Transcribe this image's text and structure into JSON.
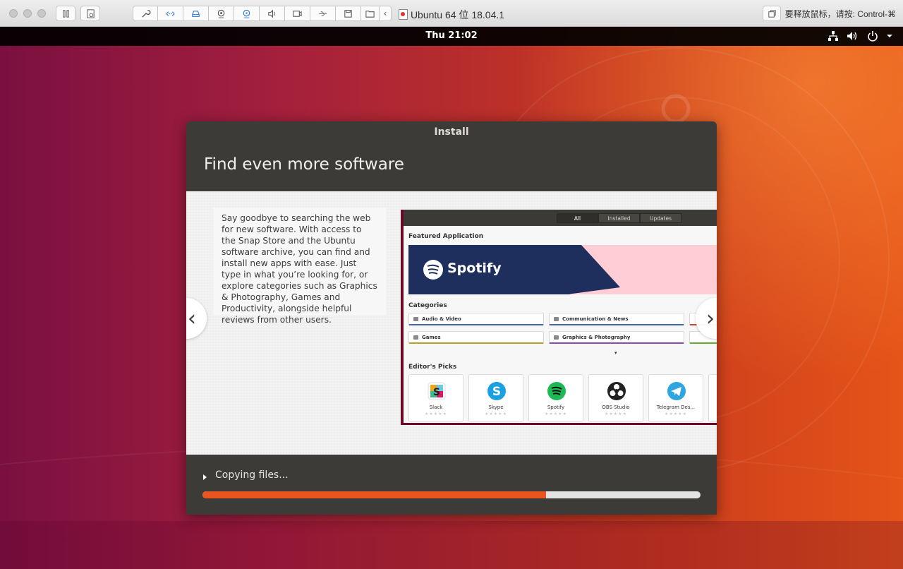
{
  "host_window": {
    "title": "Ubuntu 64 位 18.04.1",
    "release_hint": "要释放鼠标，请按: Control-⌘",
    "toolbar_icons": [
      "pause-icon",
      "snapshot-icon",
      "settings-wrench-icon",
      "network-adapter-icon",
      "hard-disk-icon",
      "camera-icon",
      "optical-drive-icon",
      "sound-icon",
      "video-icon",
      "usb-icon",
      "floppy-icon",
      "shared-folder-icon",
      "collapse-chevron-icon",
      "fullscreen-icon"
    ]
  },
  "panel": {
    "clock": "Thu 21:02",
    "tray_icons": [
      "network-icon",
      "volume-icon",
      "power-icon",
      "chevron-down-icon"
    ]
  },
  "installer": {
    "window_title": "Install",
    "heading": "Find even more software",
    "slide_text": "Say goodbye to searching the web for new software. With access to the Snap Store and the Ubuntu software archive, you can find and install new apps with ease. Just type in what you’re looking for, or explore categories such as Graphics & Photography, Games and Productivity, alongside helpful reviews from other users.",
    "prev_glyph": "‹",
    "next_glyph": "›",
    "progress": {
      "label": "Copying files...",
      "fraction": 0.69
    }
  },
  "software_preview": {
    "tabs": [
      "All",
      "Installed",
      "Updates"
    ],
    "featured_heading": "Featured Application",
    "featured_app": "Spotify",
    "categories_heading": "Categories",
    "categories": [
      "Audio & Video",
      "Communication & News",
      "Games",
      "Graphics & Photography"
    ],
    "picks_heading": "Editor's Picks",
    "picks": [
      {
        "name": "Slack",
        "color": "#ffffff"
      },
      {
        "name": "Skype",
        "color": "#1ba1e2"
      },
      {
        "name": "Spotify",
        "color": "#1db954"
      },
      {
        "name": "OBS Studio",
        "color": "#222222"
      },
      {
        "name": "Telegram Des...",
        "color": "#2ca5e0"
      }
    ],
    "stars": "★★★★★"
  },
  "colors": {
    "ubuntu_orange": "#e95420",
    "installer_bg": "#3c3b37",
    "spotify_banner": "#1e2e5d",
    "spotify_pink": "#ffcdd6"
  }
}
